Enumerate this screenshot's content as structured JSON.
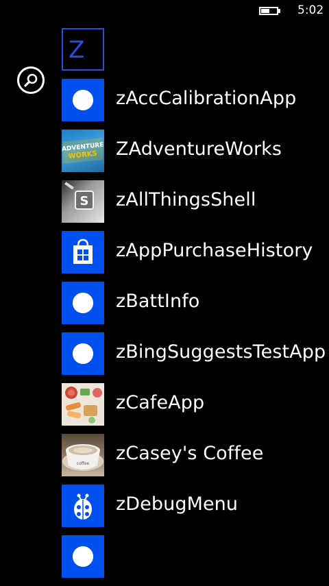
{
  "status_bar": {
    "time": "5:02",
    "battery_level": 0.55
  },
  "search": {
    "icon": "magnifier-icon"
  },
  "group_header": {
    "letter": "Z"
  },
  "apps": [
    {
      "name": "zAccCalibrationApp",
      "icon": "gear-icon"
    },
    {
      "name": "ZAdventureWorks",
      "icon": "adventure-works-logo"
    },
    {
      "name": "zAllThingsShell",
      "icon": "shell-icon"
    },
    {
      "name": "zAppPurchaseHistory",
      "icon": "store-bag-icon"
    },
    {
      "name": "zBattInfo",
      "icon": "gear-icon"
    },
    {
      "name": "zBingSuggestsTestApp",
      "icon": "gear-icon"
    },
    {
      "name": "zCafeApp",
      "icon": "food-photo"
    },
    {
      "name": "zCasey's Coffee",
      "icon": "coffee-cup-photo"
    },
    {
      "name": "zDebugMenu",
      "icon": "bug-icon"
    },
    {
      "name": "",
      "icon": "gear-icon"
    }
  ],
  "tile_art": {
    "adventure_line1": "ADVENTURE",
    "adventure_line2": "WORKS",
    "shell_letter": "S",
    "cup_text": "coffee"
  },
  "colors": {
    "accent": "#0050ef",
    "header_accent": "#1f4ee8",
    "background": "#000000",
    "text": "#ffffff"
  }
}
